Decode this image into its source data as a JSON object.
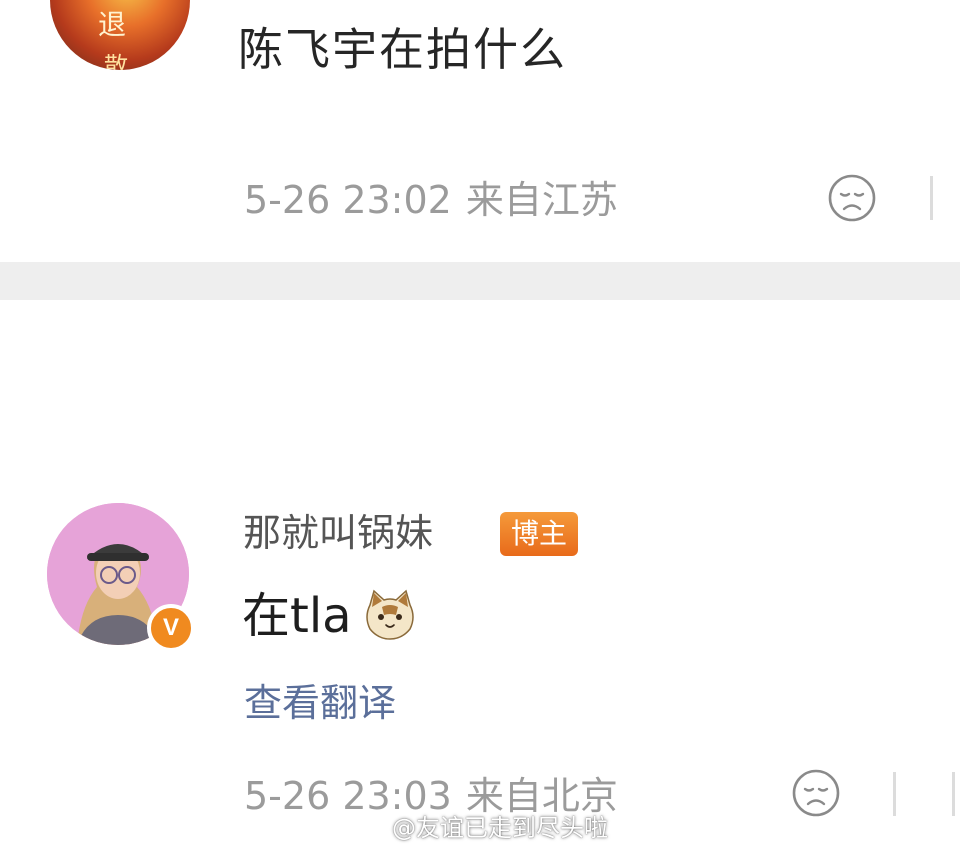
{
  "comment_1": {
    "avatar_overlay_text_1": "退",
    "avatar_overlay_text_2": "散",
    "text": "陈飞宇在拍什么",
    "date": "5-26 23:02",
    "location": "来自江苏",
    "reaction_icon": "sad-face-icon"
  },
  "comment_2": {
    "username": "那就叫锅妹",
    "tag": "博主",
    "verified_badge": "V",
    "text": "在tla",
    "emoji_icon": "cat-face-icon",
    "translate_link": "查看翻译",
    "date": "5-26 23:03",
    "location": "来自北京",
    "reaction_icon": "sad-face-icon"
  },
  "watermark": {
    "text": "@友谊已走到尽头啦",
    "logo_icon": "weibo-logo-icon"
  },
  "colors": {
    "text_primary": "#262626",
    "text_meta": "#9b9b9b",
    "link": "#5b6f9a",
    "tag_orange": "#f08a1f",
    "separator": "#eeeeee"
  }
}
